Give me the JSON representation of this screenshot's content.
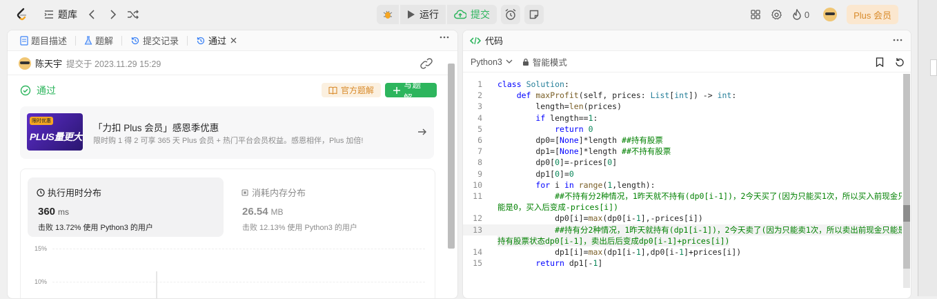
{
  "topbar": {
    "problem_bank_label": "题库",
    "run_label": "运行",
    "submit_label": "提交",
    "streak_count": "0",
    "plus_label": "Plus 会员"
  },
  "left_panel": {
    "tabs": [
      {
        "label": "题目描述"
      },
      {
        "label": "题解"
      },
      {
        "label": "提交记录"
      },
      {
        "label": "通过"
      }
    ],
    "submitter_name": "陈天宇",
    "submitted_at": "提交于 2023.11.29 15:29",
    "status": "通过",
    "official_solution_label": "官方题解",
    "write_solution_label": "写题解",
    "promo": {
      "badge": "限时优惠",
      "banner_text": "PLUS量更大",
      "title": "「力扣 Plus 会员」感恩季优惠",
      "desc": "限时购 1 得 2 可享 365 天 Plus 会员 + 热门平台会员权益。感恩相伴，Plus 加倍!"
    },
    "runtime": {
      "title": "执行用时分布",
      "value": "360",
      "unit": "ms",
      "beats": "击败 13.72% 使用 Python3 的用户"
    },
    "memory": {
      "title": "消耗内存分布",
      "value": "26.54",
      "unit": "MB",
      "beats": "击败 12.13% 使用 Python3 的用户"
    },
    "chart_ticks": [
      "15%",
      "10%"
    ]
  },
  "right_panel": {
    "title": "代码",
    "language": "Python3",
    "mode": "智能模式",
    "code_lines": [
      {
        "n": "1",
        "html": "<span class=\"kw\">class</span> <span class=\"ty\">Solution</span>:"
      },
      {
        "n": "2",
        "html": "    <span class=\"kw\">def</span> <span class=\"fn\">maxProfit</span>(self, prices: <span class=\"ty\">List</span>[<span class=\"ty\">int</span>]) -> <span class=\"ty\">int</span>:"
      },
      {
        "n": "3",
        "html": "        length=<span class=\"fn\">len</span>(prices)"
      },
      {
        "n": "4",
        "html": "        <span class=\"kw\">if</span> length==<span class=\"nm\">1</span>:"
      },
      {
        "n": "5",
        "html": "            <span class=\"kw\">return</span> <span class=\"nm\">0</span>"
      },
      {
        "n": "6",
        "html": "        dp0=[<span class=\"kw\">None</span>]*length <span class=\"cm\">##持有股票</span>"
      },
      {
        "n": "7",
        "html": "        dp1=[<span class=\"kw\">None</span>]*length <span class=\"cm\">##不持有股票</span>"
      },
      {
        "n": "8",
        "html": "        dp0[<span class=\"nm\">0</span>]=-prices[<span class=\"nm\">0</span>]"
      },
      {
        "n": "9",
        "html": "        dp1[<span class=\"nm\">0</span>]=<span class=\"nm\">0</span>"
      },
      {
        "n": "10",
        "html": "        <span class=\"kw\">for</span> i <span class=\"kw\">in</span> <span class=\"fn\">range</span>(<span class=\"nm\">1</span>,length):"
      },
      {
        "n": "11",
        "html": "            <span class=\"cm\">##不持有分2种情况，1昨天就不持有(dp0[i-1])，2今天买了(因为只能买1次，所以买入前现金只</span>",
        "wrap": "<span class=\"cm\">能是0，买入后变成-prices[i])</span>"
      },
      {
        "n": "12",
        "html": "            dp0[i]=<span class=\"fn\">max</span>(dp0[i-<span class=\"nm\">1</span>],-prices[i])"
      },
      {
        "n": "13",
        "html": "            <span class=\"cm\">##持有分2种情况，1昨天就持有(dp1[i-1])，2今天卖了(因为只能卖1次，所以卖出前现金只能是</span>",
        "wrap": "<span class=\"cm\">持有股票状态dp0[i-1]，卖出后后变成dp0[i-1]+prices[i])</span>"
      },
      {
        "n": "14",
        "html": "            dp1[i]=<span class=\"fn\">max</span>(dp1[i-<span class=\"nm\">1</span>],dp0[i-<span class=\"nm\">1</span>]+prices[i])"
      },
      {
        "n": "15",
        "html": "        <span class=\"kw\">return</span> dp1[-<span class=\"nm\">1</span>]"
      }
    ]
  }
}
